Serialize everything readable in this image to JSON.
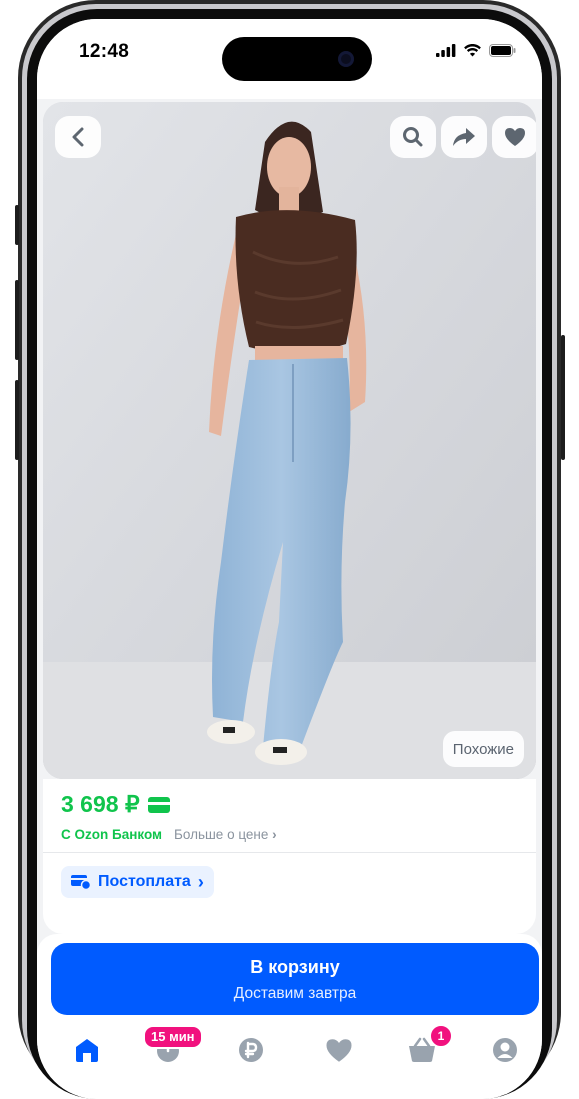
{
  "status_bar": {
    "time": "12:48"
  },
  "product": {
    "price": "3 698 ₽",
    "bank_label": "С Ozon Банком",
    "more_price_link": "Больше о цене",
    "postpay_label": "Постоплата",
    "similar_label": "Похожие",
    "photo_description_icon": "product-photo"
  },
  "cart_button": {
    "title": "В корзину",
    "subtitle": "Доставим завтра"
  },
  "tab_bar": {
    "fresh_badge": "15 мин",
    "cart_badge": "1",
    "active_color": "#005bff",
    "inactive_color": "#99a3ae"
  },
  "colors": {
    "brand_blue": "#005bff",
    "price_green": "#10c44c",
    "badge_pink": "#f1117e"
  }
}
